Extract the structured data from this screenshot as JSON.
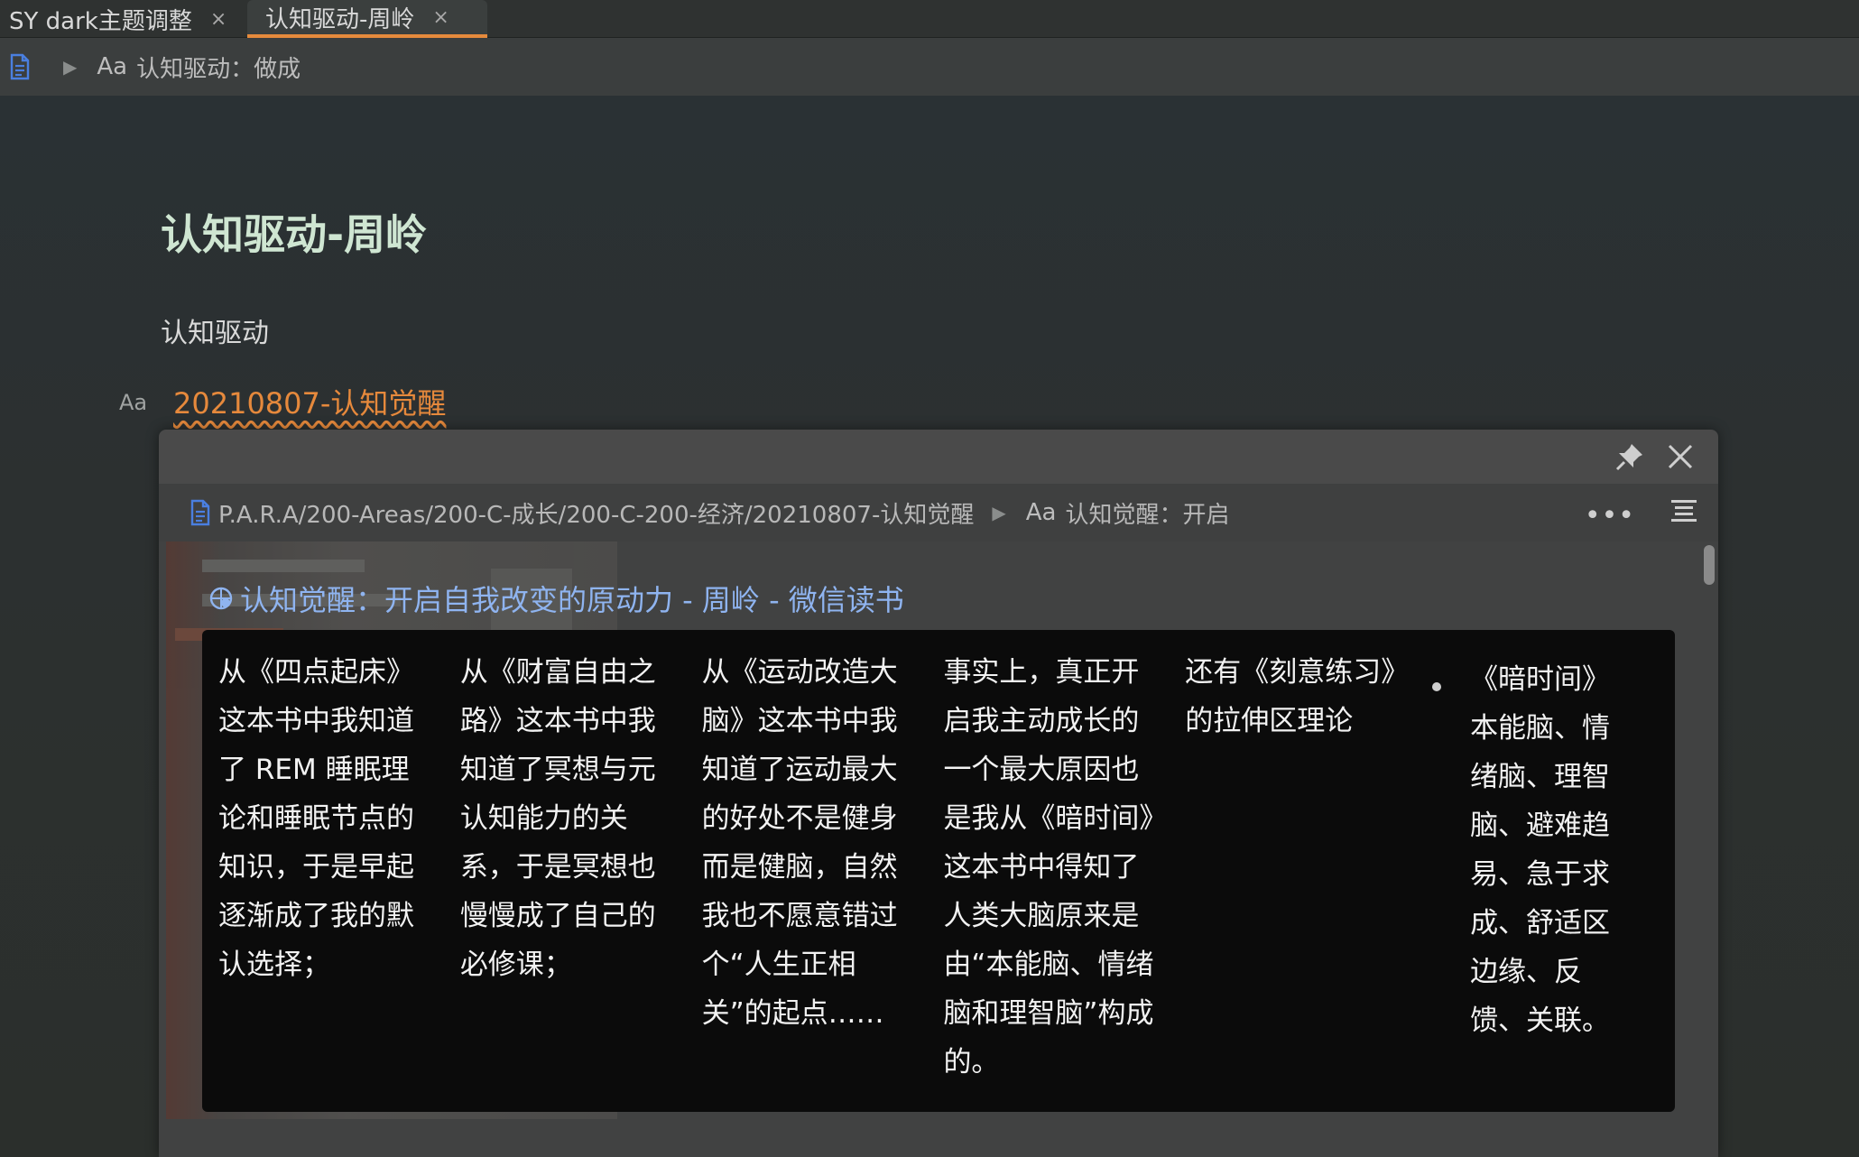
{
  "tabs": [
    {
      "label": "SY dark主题调整",
      "active": false
    },
    {
      "label": "认知驱动-周岭",
      "active": true
    }
  ],
  "tab_close_glyph": "×",
  "breadcrumb": {
    "prefix": "Aa",
    "text": "认知驱动：做成"
  },
  "document": {
    "title": "认知驱动-周岭",
    "paragraph": "认知驱动",
    "block_marker": "Aa",
    "ref_link": "20210807-认知觉醒"
  },
  "popover": {
    "path": "P.A.R.A/200-Areas/200-C-成长/200-C-200-经济/20210807-认知觉醒",
    "heading_prefix": "Aa",
    "heading": "认知觉醒：开启",
    "more_glyph": "•••",
    "link_text": "认知觉醒：开启自我改变的原动力 - 周岭 - 微信读书",
    "table": {
      "cells": [
        "从《四点起床》这本书中我知道了 REM 睡眠理论和睡眠节点的知识，于是早起逐渐成了我的默认选择；",
        "从《财富自由之路》这本书中我知道了冥想与元认知能力的关系，于是冥想也慢慢成了自己的必修课；",
        "从《运动改造大脑》这本书中我知道了运动最大的好处不是健身而是健脑，自然我也不愿意错过个“人生正相关”的起点……",
        "事实上，真正开启我主动成长的一个最大原因也是我从《暗时间》这本书中得知了人类大脑原来是由“本能脑、情绪脑和理智脑”构成的。",
        "还有《刻意练习》的拉伸区理论"
      ],
      "bullet_item": "《暗时间》本能脑、情绪脑、理智脑、避难趋易、急于求成、舒适区边缘、反馈、关联。"
    }
  },
  "colors": {
    "accent_orange": "#e68a3c",
    "link_blue": "#8fb4f0",
    "title_green": "#cfe6d2",
    "doc_icon_blue": "#4a7fe0"
  }
}
